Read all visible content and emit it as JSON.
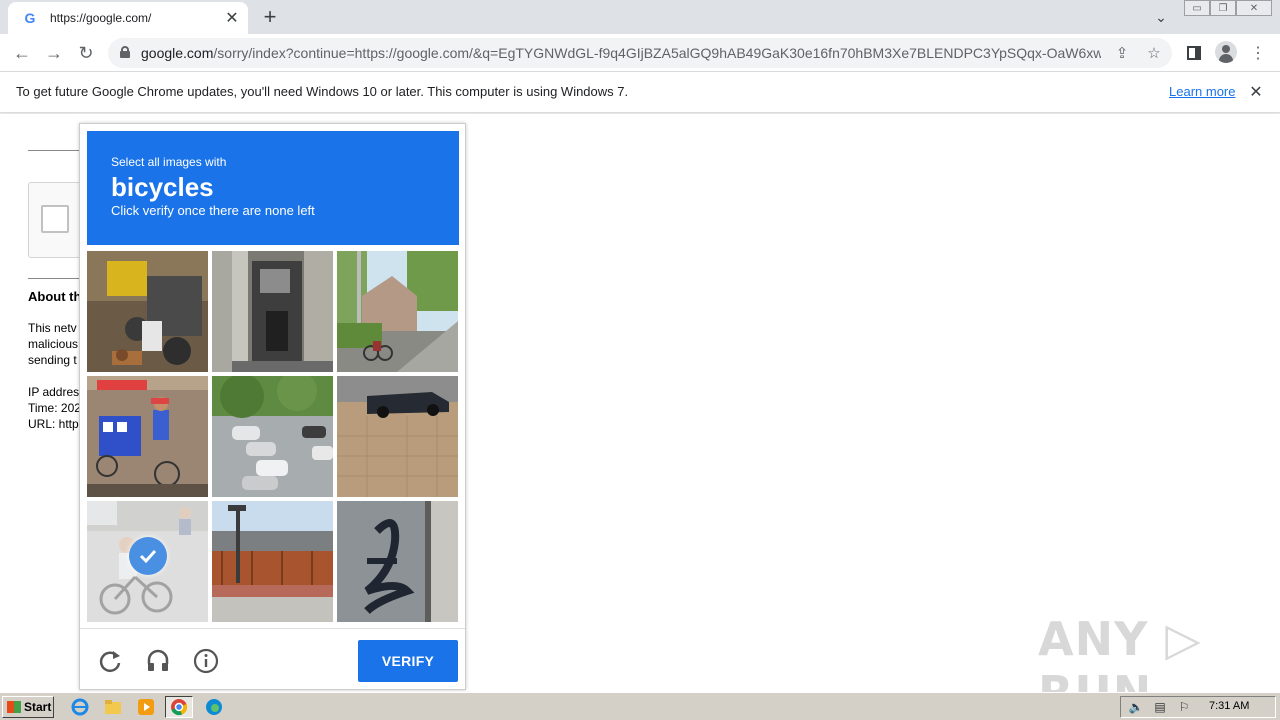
{
  "browser": {
    "tab": {
      "favicon": "G",
      "title": "https://google.com/",
      "close": "✕"
    },
    "new_tab": "+",
    "tab_search": "⌄",
    "window_controls": [
      "▭",
      "❐",
      "✕"
    ]
  },
  "toolbar": {
    "url_host": "google.com",
    "url_path": "/sorry/index?continue=https://google.com/&q=EgTYGNWdGL-f9q4GIjBZA5alGQ9hAB49GaK30e16fn70hBM3Xe7BLENDPC3YpSQqx-OaW6xwL..."
  },
  "infobar": {
    "message": "To get future Google Chrome updates, you'll need Windows 10 or later. This computer is using Windows 7.",
    "link": "Learn more",
    "close": "✕"
  },
  "page": {
    "about_heading": "About th",
    "lines": [
      "This netv",
      "malicious",
      "sending t",
      "IP addres",
      "Time: 202",
      "URL: http"
    ]
  },
  "captcha": {
    "instruction": "Select all images with",
    "object": "bicycles",
    "sub_instruction": "Click verify once there are none left",
    "verify_label": "VERIFY",
    "tiles": [
      {
        "id": 1,
        "content": "street-vendor-cart",
        "selected": false
      },
      {
        "id": 2,
        "content": "doorway-machine",
        "selected": false
      },
      {
        "id": 3,
        "content": "tree-lined-street-with-bicycle",
        "selected": false
      },
      {
        "id": 4,
        "content": "vendor-tricycle",
        "selected": false
      },
      {
        "id": 5,
        "content": "parked-cars-aerial",
        "selected": false
      },
      {
        "id": 6,
        "content": "parked-car-brick-pavement",
        "selected": false
      },
      {
        "id": 7,
        "content": "cyclist-on-street",
        "selected": true
      },
      {
        "id": 8,
        "content": "train-station-platform",
        "selected": false
      },
      {
        "id": 9,
        "content": "graffiti-wall",
        "selected": false
      }
    ]
  },
  "watermark": "ANY ▷ RUN",
  "taskbar": {
    "start_label": "Start",
    "clock": "7:31 AM"
  },
  "colors": {
    "captcha_blue": "#1a73e8",
    "link_blue": "#1a73e8",
    "taskbar": "#d4d0c8"
  }
}
